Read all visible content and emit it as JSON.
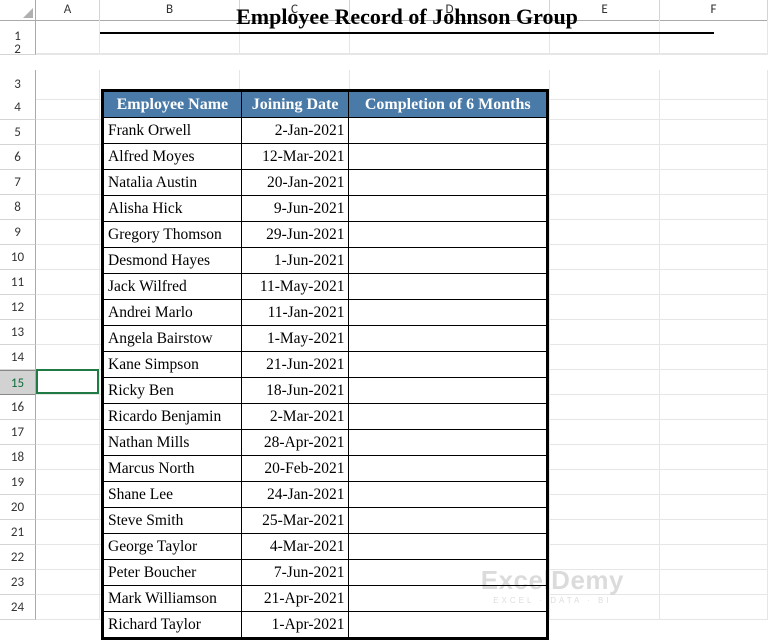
{
  "columns": [
    "",
    "A",
    "B",
    "C",
    "D",
    "E",
    "F"
  ],
  "rows": [
    "1",
    "2",
    "3",
    "4",
    "5",
    "6",
    "7",
    "8",
    "9",
    "10",
    "11",
    "12",
    "13",
    "14",
    "15",
    "16",
    "17",
    "18",
    "19",
    "20",
    "21",
    "22",
    "23",
    "24"
  ],
  "selectedRowLabel": "15",
  "title": "Employee Record of Johnson Group",
  "headers": {
    "name": "Employee Name",
    "date": "Joining Date",
    "comp": "Completion of 6 Months"
  },
  "employees": [
    {
      "name": "Frank Orwell",
      "date": "2-Jan-2021",
      "comp": ""
    },
    {
      "name": "Alfred Moyes",
      "date": "12-Mar-2021",
      "comp": ""
    },
    {
      "name": "Natalia Austin",
      "date": "20-Jan-2021",
      "comp": ""
    },
    {
      "name": "Alisha Hick",
      "date": "9-Jun-2021",
      "comp": ""
    },
    {
      "name": "Gregory Thomson",
      "date": "29-Jun-2021",
      "comp": ""
    },
    {
      "name": "Desmond Hayes",
      "date": "1-Jun-2021",
      "comp": ""
    },
    {
      "name": "Jack Wilfred",
      "date": "11-May-2021",
      "comp": ""
    },
    {
      "name": "Andrei Marlo",
      "date": "11-Jan-2021",
      "comp": ""
    },
    {
      "name": "Angela Bairstow",
      "date": "1-May-2021",
      "comp": ""
    },
    {
      "name": "Kane Simpson",
      "date": "21-Jun-2021",
      "comp": ""
    },
    {
      "name": "Ricky Ben",
      "date": "18-Jun-2021",
      "comp": ""
    },
    {
      "name": "Ricardo Benjamin",
      "date": "2-Mar-2021",
      "comp": ""
    },
    {
      "name": "Nathan Mills",
      "date": "28-Apr-2021",
      "comp": ""
    },
    {
      "name": "Marcus North",
      "date": "20-Feb-2021",
      "comp": ""
    },
    {
      "name": "Shane Lee",
      "date": "24-Jan-2021",
      "comp": ""
    },
    {
      "name": "Steve Smith",
      "date": "25-Mar-2021",
      "comp": ""
    },
    {
      "name": "George Taylor",
      "date": "4-Mar-2021",
      "comp": ""
    },
    {
      "name": "Peter Boucher",
      "date": "7-Jun-2021",
      "comp": ""
    },
    {
      "name": "Mark Williamson",
      "date": "21-Apr-2021",
      "comp": ""
    },
    {
      "name": "Richard Taylor",
      "date": "1-Apr-2021",
      "comp": ""
    }
  ],
  "watermark": {
    "main": "ExcelDemy",
    "sub": "EXCEL · DATA · BI"
  },
  "chart_data": {
    "type": "table",
    "title": "Employee Record of Johnson Group",
    "columns": [
      "Employee Name",
      "Joining Date",
      "Completion of 6 Months"
    ],
    "rows": [
      [
        "Frank Orwell",
        "2-Jan-2021",
        ""
      ],
      [
        "Alfred Moyes",
        "12-Mar-2021",
        ""
      ],
      [
        "Natalia Austin",
        "20-Jan-2021",
        ""
      ],
      [
        "Alisha Hick",
        "9-Jun-2021",
        ""
      ],
      [
        "Gregory Thomson",
        "29-Jun-2021",
        ""
      ],
      [
        "Desmond Hayes",
        "1-Jun-2021",
        ""
      ],
      [
        "Jack Wilfred",
        "11-May-2021",
        ""
      ],
      [
        "Andrei Marlo",
        "11-Jan-2021",
        ""
      ],
      [
        "Angela Bairstow",
        "1-May-2021",
        ""
      ],
      [
        "Kane Simpson",
        "21-Jun-2021",
        ""
      ],
      [
        "Ricky Ben",
        "18-Jun-2021",
        ""
      ],
      [
        "Ricardo Benjamin",
        "2-Mar-2021",
        ""
      ],
      [
        "Nathan Mills",
        "28-Apr-2021",
        ""
      ],
      [
        "Marcus North",
        "20-Feb-2021",
        ""
      ],
      [
        "Shane Lee",
        "24-Jan-2021",
        ""
      ],
      [
        "Steve Smith",
        "25-Mar-2021",
        ""
      ],
      [
        "George Taylor",
        "4-Mar-2021",
        ""
      ],
      [
        "Peter Boucher",
        "7-Jun-2021",
        ""
      ],
      [
        "Mark Williamson",
        "21-Apr-2021",
        ""
      ],
      [
        "Richard Taylor",
        "1-Apr-2021",
        ""
      ]
    ]
  }
}
